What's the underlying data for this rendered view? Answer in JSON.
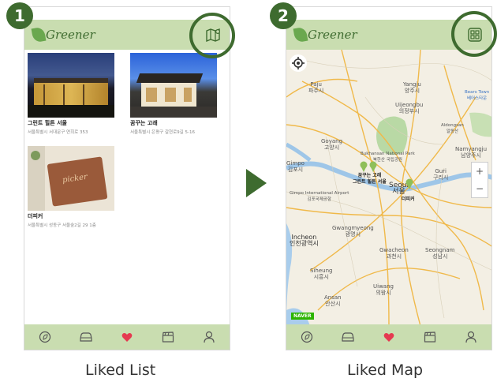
{
  "app_name": "Greener",
  "steps": [
    "1",
    "2"
  ],
  "captions": {
    "list": "Liked List",
    "map": "Liked Map"
  },
  "colors": {
    "brand": "#c9ddb0",
    "accent": "#3e6b2f",
    "heart": "#e53950"
  },
  "liked_list": {
    "items": [
      {
        "title": "그린트 힐튼 서울",
        "addr": "서울특별시 서대문구 연희로 353",
        "icon": "building-night-photo"
      },
      {
        "title": "꿈꾸는 고래",
        "addr": "서울특별시 은평구 갈현로9길 5-16",
        "icon": "house-photo"
      },
      {
        "title": "더피커",
        "addr": "서울특별시 성동구 서울숲2길 29 1층",
        "icon": "wood-sign-photo"
      }
    ]
  },
  "header_icons": {
    "list_screen": "map-icon",
    "map_screen": "grid-icon"
  },
  "nav": [
    "eco-icon",
    "car-icon",
    "heart-icon",
    "clapper-icon",
    "user-icon"
  ],
  "map": {
    "labels": [
      {
        "text": "Paju\n파주시"
      },
      {
        "text": "Yangju\n양주시"
      },
      {
        "text": "Uijeongbu\n의정부시"
      },
      {
        "text": "Goyang\n고양시"
      },
      {
        "text": "Bukhansan National Park\n북한산 국립공원"
      },
      {
        "text": "Namyangju\n남양주시"
      },
      {
        "text": "Guri\n구리시"
      },
      {
        "text": "Seoul\n서울"
      },
      {
        "text": "Gimpo International Airport\n김포국제공항"
      },
      {
        "text": "Gwangmyeong\n광명시"
      },
      {
        "text": "Incheon\n인천광역시"
      },
      {
        "text": "Gwacheon\n과천시"
      },
      {
        "text": "Seongnam\n성남시"
      },
      {
        "text": "Siheung\n시흥시"
      },
      {
        "text": "Uiwang\n의왕시"
      },
      {
        "text": "Ansan\n안산시"
      },
      {
        "text": "Aldongsan\n알동산"
      },
      {
        "text": "Bears Town\n베어스타운"
      },
      {
        "text": "Gimpo\n김포시"
      }
    ],
    "pins": [
      {
        "text": "꿈꾸는 고래\n그린트 힐튼 서울"
      },
      {
        "text": "더피커"
      }
    ],
    "naver": "NAVER",
    "zoom_in": "+",
    "zoom_out": "−"
  }
}
